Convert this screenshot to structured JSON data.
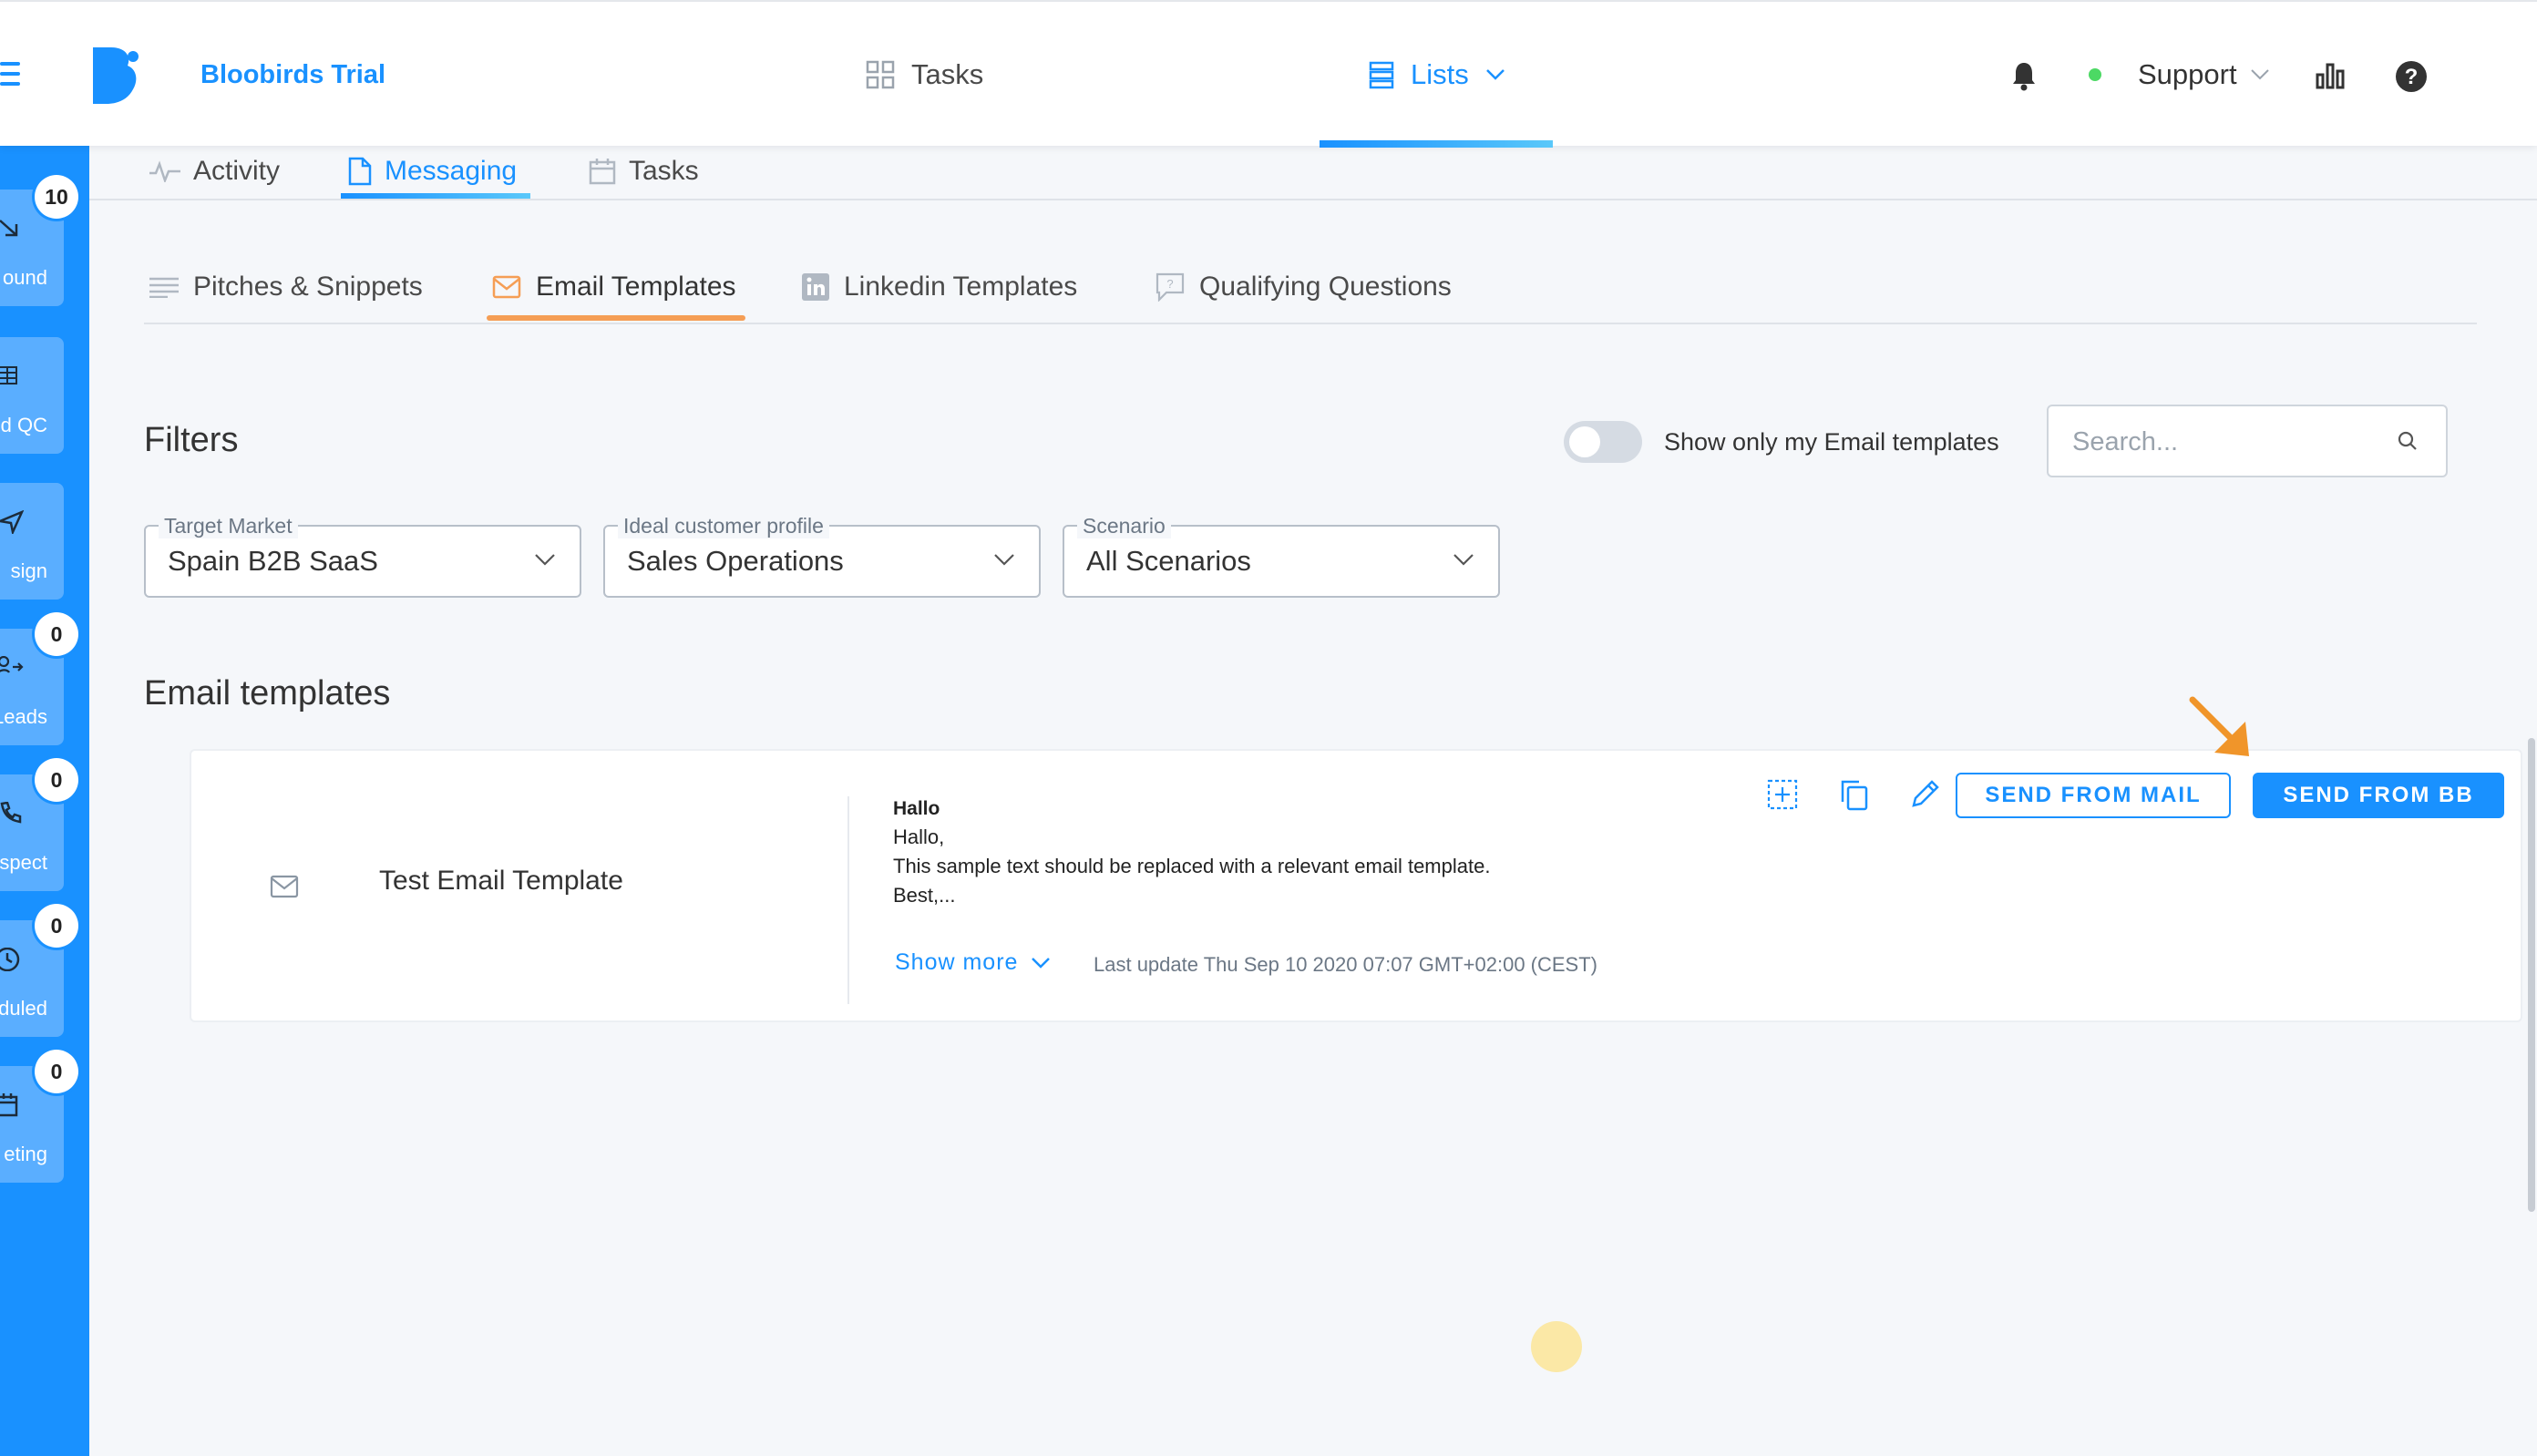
{
  "header": {
    "brand": "Bloobirds Trial",
    "nav": {
      "tasks": "Tasks",
      "lists": "Lists"
    },
    "user": "Support",
    "status_color": "#4cd964",
    "accent": "#1991ff"
  },
  "sidebar": {
    "items": [
      {
        "label": "ound",
        "icon": "arrow-down-right-icon",
        "badge": "10"
      },
      {
        "label": "d QC",
        "icon": "table-icon",
        "badge": ""
      },
      {
        "label": "sign",
        "icon": "send-icon",
        "badge": ""
      },
      {
        "label": "Leads",
        "icon": "user-arrow-icon",
        "badge": "0"
      },
      {
        "label": "spect",
        "icon": "phone-icon",
        "badge": "0"
      },
      {
        "label": "eduled",
        "icon": "clock-icon",
        "badge": "0"
      },
      {
        "label": "eting",
        "icon": "calendar-icon",
        "badge": "0"
      }
    ]
  },
  "subtabs": {
    "activity": "Activity",
    "messaging": "Messaging",
    "tasks": "Tasks"
  },
  "template_tabs": {
    "pitches": "Pitches & Snippets",
    "email": "Email Templates",
    "linkedin": "Linkedin Templates",
    "qualifying": "Qualifying Questions"
  },
  "filters": {
    "title": "Filters",
    "toggle_label": "Show only my Email templates",
    "search_placeholder": "Search...",
    "target_market": {
      "label": "Target Market",
      "value": "Spain B2B SaaS"
    },
    "icp": {
      "label": "Ideal customer profile",
      "value": "Sales Operations"
    },
    "scenario": {
      "label": "Scenario",
      "value": "All Scenarios"
    }
  },
  "email_templates": {
    "title": "Email templates",
    "items": [
      {
        "name": "Test Email Template",
        "subject": "Hallo",
        "body": [
          "Hallo,",
          "This sample text should be replaced with a relevant email template.",
          "Best,..."
        ],
        "show_more": "Show more",
        "last_update": "Last update Thu Sep 10 2020 07:07 GMT+02:00 (CEST)",
        "send_from_mail": "SEND FROM MAIL",
        "send_from_bb": "SEND FROM BB"
      }
    ]
  }
}
